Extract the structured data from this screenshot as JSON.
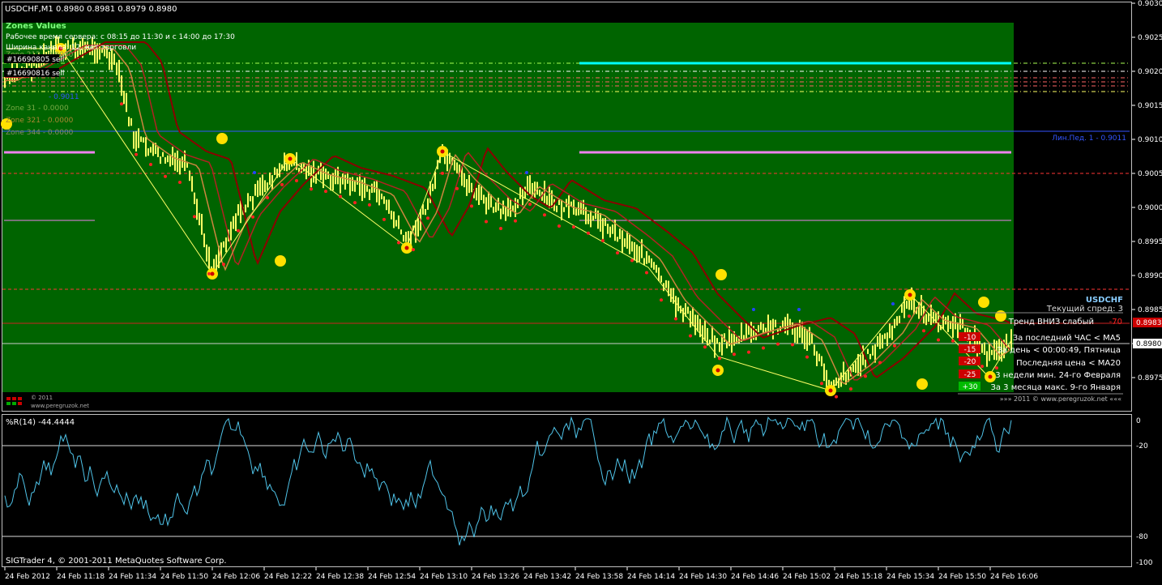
{
  "window": {
    "symbol_header": "USDCHF,M1  0.8980 0.8981 0.8979 0.8980"
  },
  "zones_panel": {
    "title": "Zones Values",
    "work_time": "Рабочее время сервера: с 08:15 до 11:30 и с 14:00 до 17:30",
    "channel_width": "Ширина канала: 12, нет торговли",
    "order_1": "#16690805 sell",
    "order_2": "#16690816 sell",
    "zone_212": "Zone 212 - 0.0000",
    "zone_31": "Zone 31 - 0.0000",
    "zone_321": "Zone 321 - 0.0000",
    "zone_344": "Zone 344 - 0.0000",
    "zone_blue": "- 0.9011"
  },
  "line_label": "Лин.Пед. 1 - 0.9011",
  "info_panel": {
    "symbol": "USDCHF",
    "spread": "Текущий спред: 3",
    "trend": "Тренд ВНИЗ слабый",
    "trend_value": "-70",
    "row_1": "За последний ЧАС < MA5",
    "row_2": "За день < 00:00:49, Пятница",
    "row_3": "Последняя цена < MA20",
    "row_4": "3 недели мин. 24-го Февраля",
    "row_5": "За 3 месяца макс. 9-го Января",
    "badge_1": "-10",
    "badge_2": "-15",
    "badge_3": "-20",
    "badge_4": "-25",
    "badge_5": "+30",
    "footer": "»»»    2011  ©  www.peregruzok.net    «««"
  },
  "watermark": {
    "line1": "© 2011",
    "line2": "www.peregruzok.net"
  },
  "price_axis": [
    "0.9030",
    "0.9025",
    "0.9020",
    "0.9015",
    "0.9010",
    "0.9005",
    "0.9000",
    "0.8995",
    "0.8990",
    "0.8985",
    "0.8980",
    "0.8975"
  ],
  "price_marker_red": "0.8983",
  "price_marker_cur": "0.8980",
  "indicator": {
    "label": "%R(14) -44.4444",
    "axis_0": "0",
    "axis_20": "-20",
    "axis_80": "-80",
    "axis_100": "-100"
  },
  "copyright": "SIGTrader 4, © 2001-2011 MetaQuotes Software Corp.",
  "time_axis": [
    "24 Feb 2012",
    "24 Feb 11:18",
    "24 Feb 11:34",
    "24 Feb 11:50",
    "24 Feb 12:06",
    "24 Feb 12:22",
    "24 Feb 12:38",
    "24 Feb 12:54",
    "24 Feb 13:10",
    "24 Feb 13:26",
    "24 Feb 13:42",
    "24 Feb 13:58",
    "24 Feb 14:14",
    "24 Feb 14:30",
    "24 Feb 14:46",
    "24 Feb 15:02",
    "24 Feb 15:18",
    "24 Feb 15:34",
    "24 Feb 15:50",
    "24 Feb 16:06"
  ],
  "colors": {
    "zone_green": "#006400",
    "candles": "#ffff66",
    "wpr_line": "#4fc3e8",
    "cyan_level": "#00ffff",
    "violet_level": "#ee82ee",
    "ma_dark": "#8b0000",
    "ma_mid": "#b22222",
    "ma_light": "#cd853f"
  }
}
